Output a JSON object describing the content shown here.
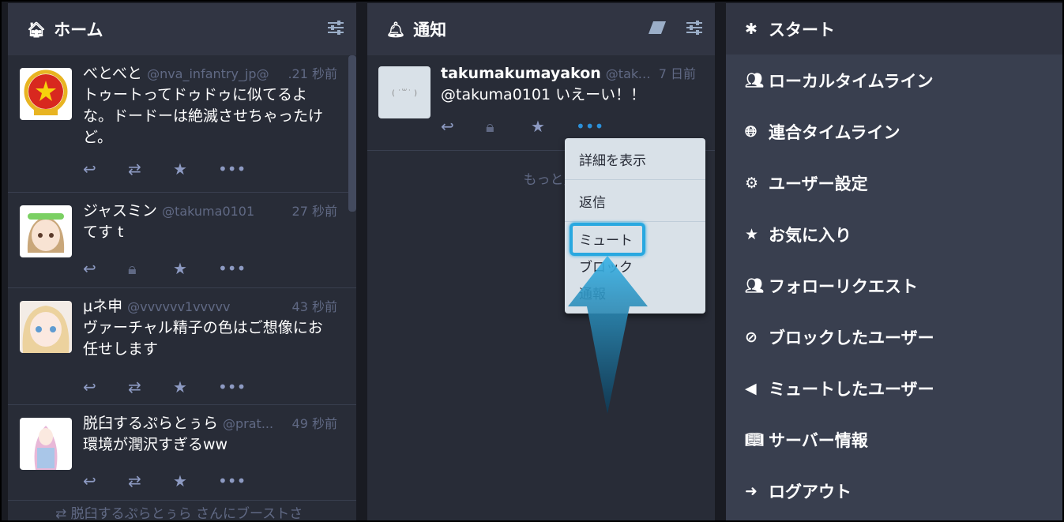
{
  "home": {
    "title": "ホーム",
    "statuses": [
      {
        "name": "べとべと",
        "acct": "@nva_infantry_jp@",
        "time": ".21 秒前",
        "content": "トゥートってドゥドゥに似てるよな。ドードーは絶滅させちゃったけど。"
      },
      {
        "name": "ジャスミン",
        "acct": "@takuma0101",
        "time": "27 秒前",
        "content": "てす t"
      },
      {
        "name": "μネ申",
        "acct": "@vvvvvv1vvvvv",
        "time": "43 秒前",
        "content": "ヴァーチャル精子の色はご想像にお任せします"
      },
      {
        "name": "脱臼するぷらとぅら",
        "acct": "@prat...",
        "time": "49 秒前",
        "content": "環境が潤沢すぎるww"
      }
    ],
    "boost_peek": "脱臼するぷらとぅら さんにブーストさ"
  },
  "notifications": {
    "title": "通知",
    "status": {
      "name": "takumakumayakon",
      "acct": "@takum...",
      "time": "7 日前",
      "content": "@takuma0101 いえーい！！",
      "avatar_text": "( ˙꒳˙ )"
    },
    "load_more": "もっと見る"
  },
  "dropdown": {
    "items": [
      "詳細を表示",
      "返信",
      "ミュート",
      "ブロック",
      "通報"
    ]
  },
  "start": {
    "title": "スタート",
    "items": [
      {
        "label": "ローカルタイムライン",
        "icon": "users-icon"
      },
      {
        "label": "連合タイムライン",
        "icon": "globe-icon"
      },
      {
        "label": "ユーザー設定",
        "icon": "gear-icon"
      },
      {
        "label": "お気に入り",
        "icon": "star-icon"
      },
      {
        "label": "フォローリクエスト",
        "icon": "users-icon"
      },
      {
        "label": "ブロックしたユーザー",
        "icon": "ban-icon"
      },
      {
        "label": "ミュートしたユーザー",
        "icon": "volume-off-icon"
      },
      {
        "label": "サーバー情報",
        "icon": "book-icon"
      },
      {
        "label": "ログアウト",
        "icon": "sign-out-icon"
      }
    ]
  },
  "colors": {
    "accent": "#2b90d9",
    "highlight": "#29a8e0",
    "background": "#282c37"
  }
}
